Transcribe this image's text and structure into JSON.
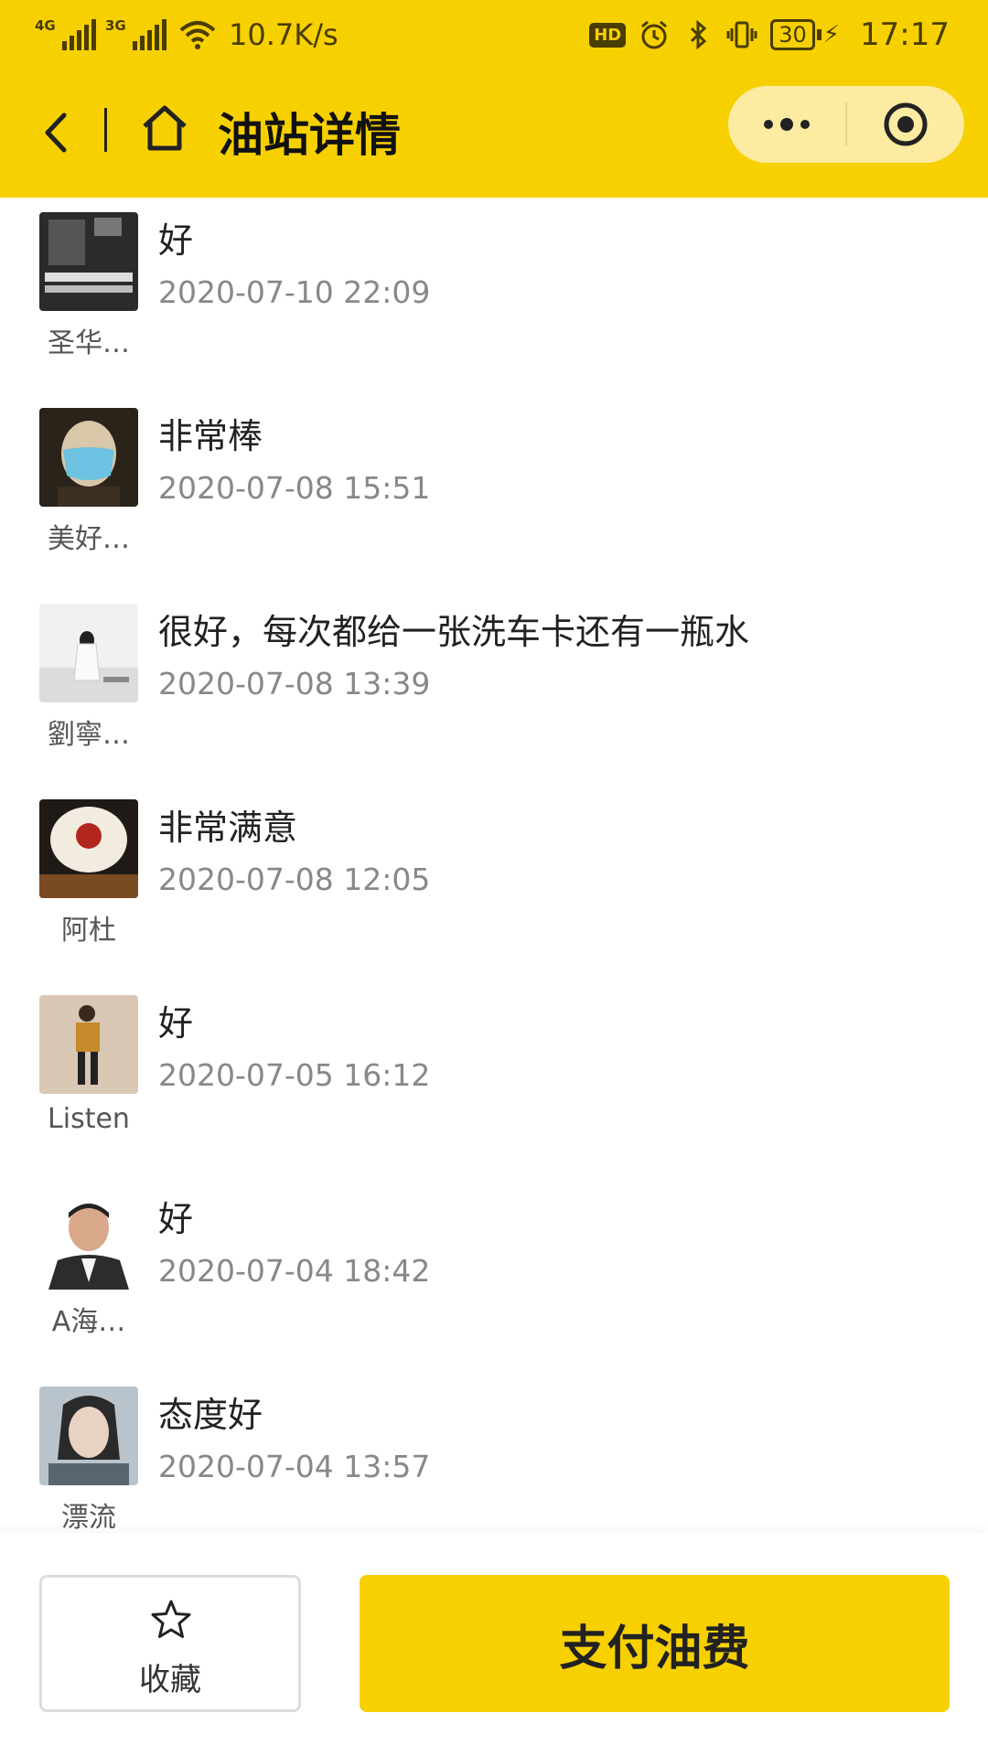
{
  "status_bar": {
    "signal_1": "4G",
    "signal_2": "3G",
    "speed": "10.7K/s",
    "hd": "HD",
    "battery": "30",
    "time": "17:17"
  },
  "nav": {
    "title": "油站详情"
  },
  "comments": [
    {
      "user": "圣华…",
      "text": "好",
      "time": "2020-07-10 22:09"
    },
    {
      "user": "美好…",
      "text": "非常棒",
      "time": "2020-07-08 15:51"
    },
    {
      "user": "劉寧…",
      "text": "很好，每次都给一张洗车卡还有一瓶水",
      "time": "2020-07-08 13:39"
    },
    {
      "user": "阿杜",
      "text": "非常满意",
      "time": "2020-07-08 12:05"
    },
    {
      "user": "Listen",
      "text": "好",
      "time": "2020-07-05 16:12"
    },
    {
      "user": "A海…",
      "text": "好",
      "time": "2020-07-04 18:42"
    },
    {
      "user": "漂流",
      "text": "态度好",
      "time": "2020-07-04 13:57"
    }
  ],
  "bottom": {
    "favorite_label": "收藏",
    "pay_label": "支付油费"
  },
  "colors": {
    "brand_yellow": "#F7D000",
    "capsule_bg": "#FCEBA0"
  }
}
